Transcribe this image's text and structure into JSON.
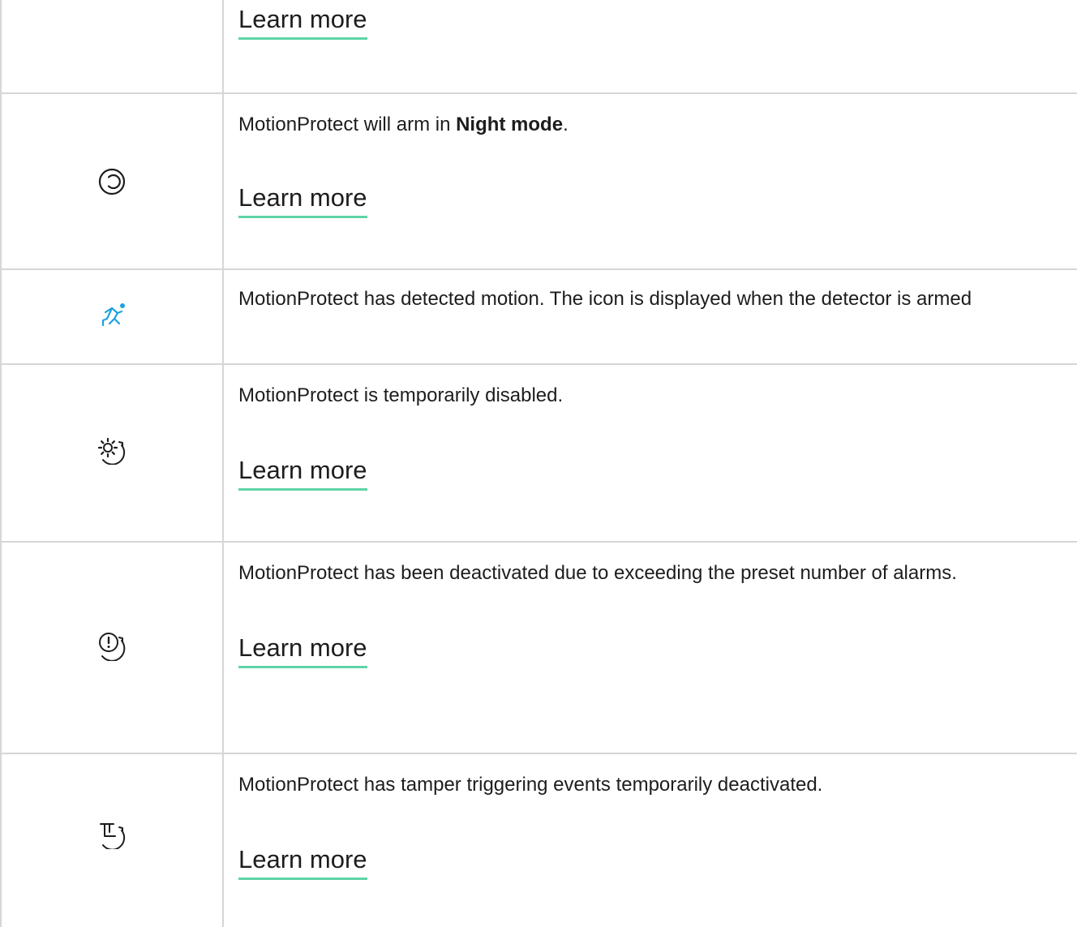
{
  "rows": [
    {
      "icon": "none",
      "description": "",
      "link": "Learn more"
    },
    {
      "icon": "night-mode-icon",
      "description_prefix": "MotionProtect will arm in ",
      "description_bold": "Night mode",
      "description_suffix": ".",
      "link": "Learn more"
    },
    {
      "icon": "motion-detected-icon",
      "description": "MotionProtect has detected motion. The icon is displayed when the detector is armed"
    },
    {
      "icon": "temporarily-disabled-icon",
      "description": "MotionProtect is temporarily disabled.",
      "link": "Learn more"
    },
    {
      "icon": "alarm-deactivated-icon",
      "description": "MotionProtect has been deactivated due to exceeding the preset number of alarms.",
      "link": "Learn more"
    },
    {
      "icon": "tamper-deactivated-icon",
      "description": "MotionProtect has tamper triggering events temporarily deactivated.",
      "link": "Learn more"
    }
  ],
  "colors": {
    "accent_underline": "#5fd3a6",
    "motion_icon": "#1aa3e0",
    "border": "#d6d6d6",
    "text": "#1d1d1d"
  }
}
